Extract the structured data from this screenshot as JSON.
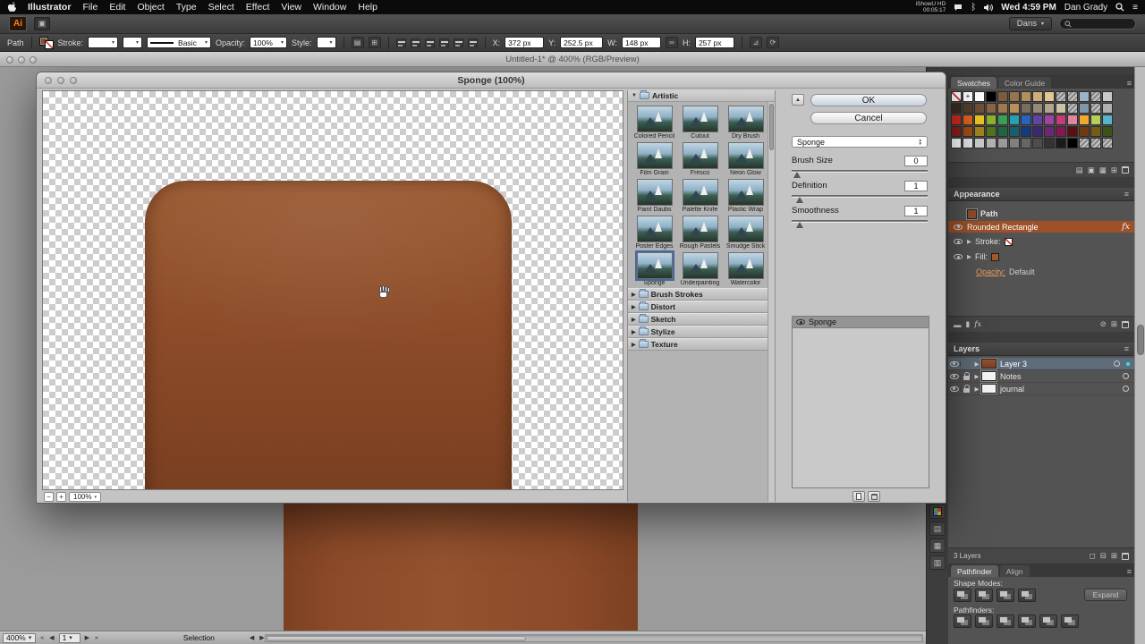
{
  "colors": {
    "shape_top": "#99572f",
    "shape_bottom": "#6f3a1e",
    "artboard_brown": "#8d4a29",
    "appearance_highlight": "#9e5128",
    "layers_selected": "#5e6b78"
  },
  "icons": {
    "disclosure_open": "▼",
    "disclosure_closed": "▶",
    "dropdown_arrow": "▾",
    "up_arrow": "▲",
    "down_arrow": "▼",
    "panel_menu": "≡",
    "dock_collapse": "«",
    "minus": "−",
    "plus": "+",
    "prev_arrow": "◀",
    "next_arrow": "▶",
    "first_arrow": "«",
    "last_arrow": "»",
    "bluetooth": "ᛒ"
  },
  "menubar": {
    "items": [
      "Illustrator",
      "File",
      "Edit",
      "Object",
      "Type",
      "Select",
      "Effect",
      "View",
      "Window",
      "Help"
    ],
    "recorder_line1": "iShowU HD",
    "recorder_line2": "00:05:17",
    "clock": "Wed 4:59 PM",
    "user": "Dan Grady"
  },
  "appbar": {
    "logo": "Ai",
    "workspace": "Dans"
  },
  "controlbar": {
    "selection_type": "Path",
    "stroke_label": "Stroke:",
    "brush_style": "Basic",
    "opacity_label": "Opacity:",
    "opacity_value": "100%",
    "style_label": "Style:",
    "x_label": "X:",
    "x_value": "372 px",
    "y_label": "Y:",
    "y_value": "252.5 px",
    "w_label": "W:",
    "w_value": "148 px",
    "h_label": "H:",
    "h_value": "257 px"
  },
  "document": {
    "title": "Untitled-1* @ 400% (RGB/Preview)"
  },
  "dialog": {
    "title": "Sponge (100%)",
    "preview_zoom": "100%",
    "filter_category": "Artistic",
    "filters": [
      "Colored Pencil",
      "Cutout",
      "Dry Brush",
      "Film Grain",
      "Fresco",
      "Neon Glow",
      "Paint Daubs",
      "Palette Knife",
      "Plastic Wrap",
      "Poster Edges",
      "Rough Pastels",
      "Smudge Stick",
      "Sponge",
      "Underpainting",
      "Watercolor"
    ],
    "selected_filter": "Sponge",
    "collapsed_categories": [
      "Brush Strokes",
      "Distort",
      "Sketch",
      "Stylize",
      "Texture"
    ],
    "ok_label": "OK",
    "cancel_label": "Cancel",
    "preset": "Sponge",
    "params": [
      {
        "label": "Brush Size",
        "value": "0"
      },
      {
        "label": "Definition",
        "value": "1"
      },
      {
        "label": "Smoothness",
        "value": "1"
      }
    ],
    "effect_layers": [
      "Sponge"
    ]
  },
  "panels": {
    "swatches": {
      "tabs": [
        "Swatches",
        "Color Guide"
      ],
      "active_tab": "Swatches",
      "grid": [
        [
          "none",
          "reg",
          "#ffffff",
          "#000000",
          "#7a5c3e",
          "#96744c",
          "#b2905e",
          "#ccae78",
          "#e2c892",
          "pattern",
          "pattern",
          "#9db4c6",
          "pattern",
          "#c8c8c8"
        ],
        [
          "#3a2c20",
          "#54402c",
          "#6e5238",
          "#886444",
          "#a27850",
          "#bc8e5c",
          "#786e5e",
          "#948a76",
          "#b0a68e",
          "#ccc2a6",
          "pattern",
          "#7e96aa",
          "pattern",
          "#b0b0b0"
        ],
        [
          "#d42a1e",
          "#e0641e",
          "#eec81e",
          "#8cb42e",
          "#3ca054",
          "#28a0b4",
          "#2864be",
          "#6044a4",
          "#a044a4",
          "#c43c78",
          "#e086a0",
          "#f0a830",
          "#b4d05a",
          "#58b4c8"
        ],
        [
          "#8c1e1e",
          "#a04e14",
          "#a4841a",
          "#507420",
          "#206444",
          "#14606e",
          "#143a80",
          "#3c2870",
          "#6c2874",
          "#821a50",
          "#5a1010",
          "#6e3a10",
          "#745c12",
          "#3c5418"
        ],
        [
          "#ffffff",
          "#e6e6e6",
          "#cccccc",
          "#b3b3b3",
          "#999999",
          "#808080",
          "#666666",
          "#4d4d4d",
          "#333333",
          "#1a1a1a",
          "#000000",
          "pattern",
          "pattern",
          "pattern"
        ]
      ]
    },
    "appearance": {
      "title": "Appearance",
      "rows": [
        {
          "label": "Path"
        },
        {
          "label": "Rounded Rectangle",
          "badge": "fx"
        },
        {
          "label": "Stroke:"
        },
        {
          "label": "Fill:"
        },
        {
          "label": "Opacity:",
          "value": "Default"
        }
      ]
    },
    "layers": {
      "title": "Layers",
      "items": [
        {
          "name": "Layer 3"
        },
        {
          "name": "Notes"
        },
        {
          "name": "journal"
        }
      ],
      "count_label": "3 Layers"
    },
    "pathfinder": {
      "tabs": [
        "Pathfinder",
        "Align"
      ],
      "shape_modes_label": "Shape Modes:",
      "pathfinders_label": "Pathfinders:",
      "expand_label": "Expand"
    }
  },
  "statusbar": {
    "zoom": "400%",
    "artboard_nav": "1",
    "tool_label": "Selection"
  }
}
